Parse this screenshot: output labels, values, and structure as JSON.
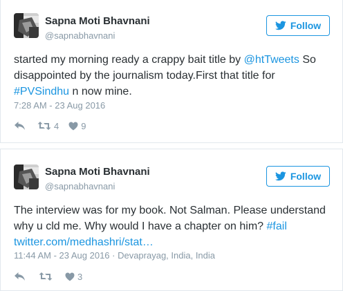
{
  "tweets": [
    {
      "name": "Sapna Moti Bhavnani",
      "handle": "@sapnabhavnani",
      "follow_label": "Follow",
      "text": {
        "p1": "started my morning ready a crappy bait title by ",
        "mention": "@htTweets",
        "p2": " So disappointed by the journalism today.First that title for ",
        "hashtag": "#PVSindhu",
        "p3": " n now mine."
      },
      "timestamp": "7:28 AM - 23 Aug 2016",
      "retweets": "4",
      "likes": "9"
    },
    {
      "name": "Sapna Moti Bhavnani",
      "handle": "@sapnabhavnani",
      "follow_label": "Follow",
      "text": {
        "p1": "The interview was for my book. Not Salman. Please understand why u cld me. Why would I have a chapter on him? ",
        "hashtag": "#fail",
        "link": "twitter.com/medhashri/stat…"
      },
      "timestamp": "11:44 AM - 23 Aug 2016",
      "location": " · Devaprayag, India, India",
      "likes": "3"
    }
  ],
  "colors": {
    "link": "#1b95e0",
    "text": "#292f33",
    "muted": "#8899a6",
    "border": "#e1e8ed"
  },
  "icons": [
    "bird-icon",
    "reply-icon",
    "retweet-icon",
    "heart-icon"
  ]
}
